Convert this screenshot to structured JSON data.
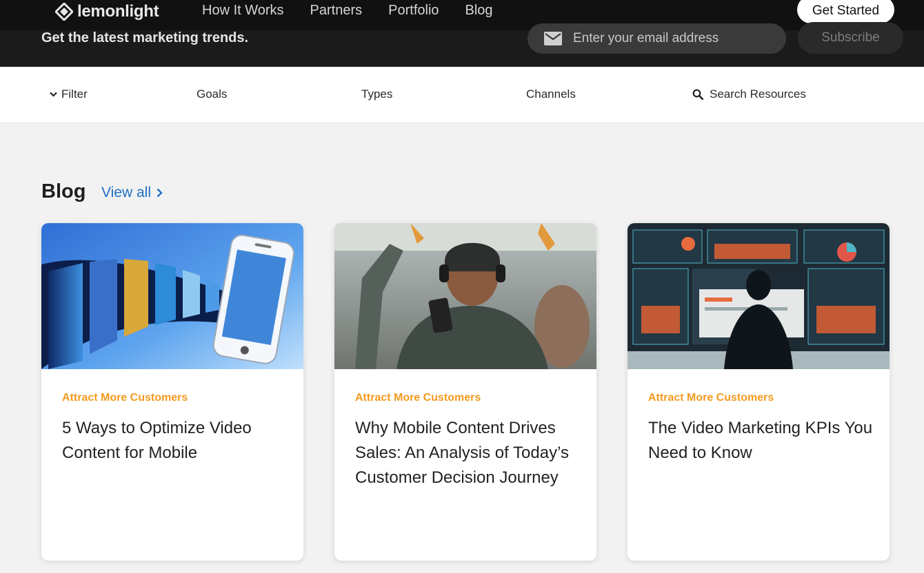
{
  "nav": {
    "logo_text": "lemonlight",
    "links": [
      "How It Works",
      "Partners",
      "Portfolio",
      "Blog"
    ],
    "cta": "Get Started"
  },
  "newsletter": {
    "text": "Get the latest marketing trends.",
    "email_placeholder": "Enter your email address",
    "subscribe_label": "Subscribe"
  },
  "filters": {
    "filter_label": "Filter",
    "goals_label": "Goals",
    "types_label": "Types",
    "channels_label": "Channels",
    "search_label": "Search Resources"
  },
  "blog": {
    "heading": "Blog",
    "view_all": "View all",
    "cards": [
      {
        "category": "Attract More Customers",
        "title": "5 Ways to Optimize Video Content for Mobile"
      },
      {
        "category": "Attract More Customers",
        "title": "Why Mobile Content Drives Sales: An Analysis of Today’s Customer Decision Journey"
      },
      {
        "category": "Attract More Customers",
        "title": "The Video Marketing KPIs You Need to Know"
      }
    ]
  },
  "colors": {
    "category": "#f39a1e",
    "link": "#1f6fc5",
    "nav_bg": "#111111"
  }
}
